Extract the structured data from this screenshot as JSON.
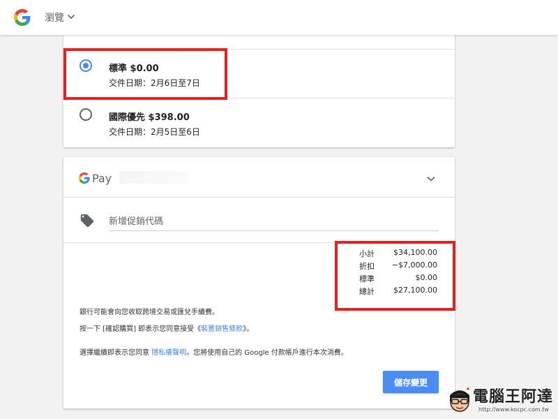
{
  "header": {
    "browse_label": "瀏覽"
  },
  "shipping": {
    "options": [
      {
        "title": "標準 $0.00",
        "delivery": "交件日期：2月6日至7日",
        "selected": true
      },
      {
        "title": "國際優先 $398.00",
        "delivery": "交件日期：2月5日至6日",
        "selected": false
      }
    ]
  },
  "payment": {
    "brand_label": "Pay",
    "promo_placeholder": "新增促銷代碼"
  },
  "summary": {
    "rows": [
      {
        "label": "小計",
        "value": "$34,100.00"
      },
      {
        "label": "折扣",
        "value": "−$7,000.00"
      },
      {
        "label": "標準",
        "value": "$0.00"
      },
      {
        "label": "總計",
        "value": "$27,100.00"
      }
    ]
  },
  "notices": {
    "bank_fee": "銀行可能會向您收取跨境交易或匯兌手續費。",
    "terms_prefix": "按一下 [確認購買] 即表示您同意接受《",
    "terms_link": "裝置銷售條款",
    "terms_suffix": "》。",
    "privacy_prefix": "選擇繼續即表示您同意 ",
    "privacy_link": "隱私權聲明",
    "privacy_suffix": "。您將使用自己的 Google 付款帳戶進行本次消費。"
  },
  "actions": {
    "save_label": "儲存變更"
  },
  "watermark": {
    "title": "電腦王阿達",
    "url": "http://www.kocpc.com.tw"
  },
  "colors": {
    "accent": "#4285f4",
    "highlight_box": "#e8201c",
    "button": "#4b8bf4"
  }
}
